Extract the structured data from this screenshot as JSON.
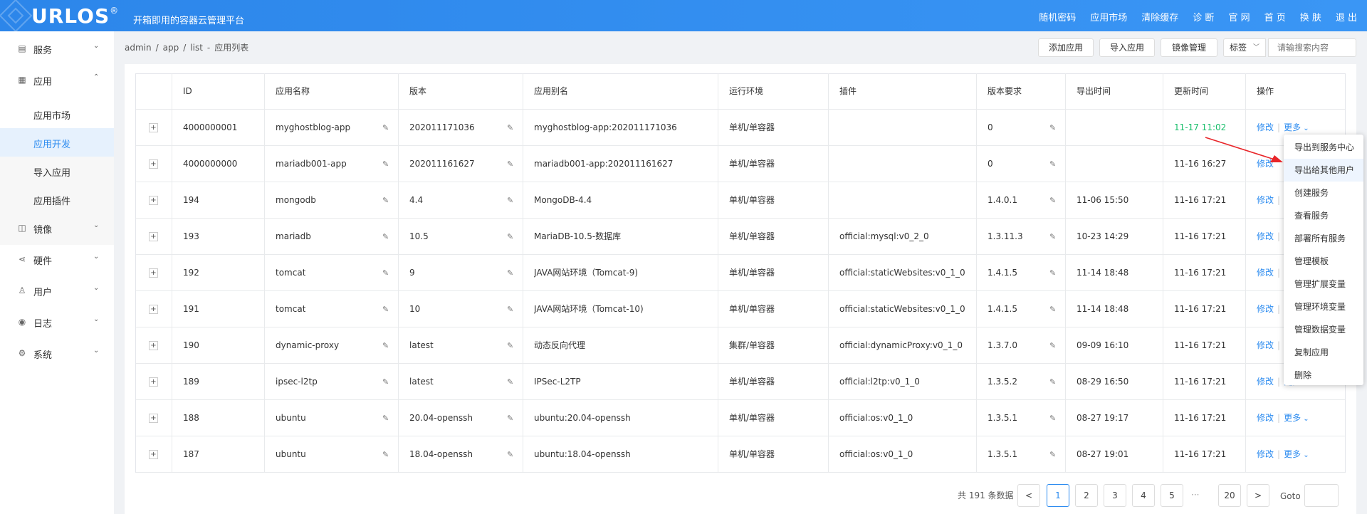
{
  "app": {
    "logo": "URLOS",
    "logo_reg": "®",
    "tagline": "开箱即用的容器云管理平台"
  },
  "topnav": [
    "随机密码",
    "应用市场",
    "清除缓存",
    "诊 断",
    "官 网",
    "首 页",
    "换 肤",
    "退 出"
  ],
  "sidebar": {
    "items": [
      {
        "label": "服务",
        "icon": "store-icon",
        "arrow": "⌄"
      },
      {
        "label": "应用",
        "icon": "grid-icon",
        "arrow": "⌃"
      },
      {
        "label": "镜像",
        "icon": "disk-icon",
        "arrow": "⌄"
      },
      {
        "label": "硬件",
        "icon": "share-icon",
        "arrow": "⌄"
      },
      {
        "label": "用户",
        "icon": "user-icon",
        "arrow": "⌄"
      },
      {
        "label": "日志",
        "icon": "eye-icon",
        "arrow": "⌄"
      },
      {
        "label": "系统",
        "icon": "gear-icon",
        "arrow": "⌄"
      }
    ],
    "subitems": [
      "应用市场",
      "应用开发",
      "导入应用",
      "应用插件"
    ],
    "active_sub": "应用开发"
  },
  "breadcrumb": {
    "parts": [
      "admin",
      "/",
      "app",
      "/",
      "list",
      "-",
      "应用列表"
    ]
  },
  "toolbar": {
    "add": "添加应用",
    "import": "导入应用",
    "image": "镜像管理",
    "tag_select": "标签",
    "search_placeholder": "请输搜索内容"
  },
  "table": {
    "columns": [
      "ID",
      "应用名称",
      "版本",
      "应用别名",
      "运行环境",
      "插件",
      "版本要求",
      "导出时间",
      "更新时间",
      "操作"
    ],
    "rows": [
      {
        "id": "4000000001",
        "name": "myghostblog-app",
        "version": "202011171036",
        "alias": "myghostblog-app:202011171036",
        "env": "单机/单容器",
        "plugin": "",
        "req": "0",
        "export": "",
        "update": "11-17 11:02",
        "update_green": true
      },
      {
        "id": "4000000000",
        "name": "mariadb001-app",
        "version": "202011161627",
        "alias": "mariadb001-app:202011161627",
        "env": "单机/单容器",
        "plugin": "",
        "req": "0",
        "export": "",
        "update": "11-16 16:27"
      },
      {
        "id": "194",
        "name": "mongodb",
        "version": "4.4",
        "alias": "MongoDB-4.4",
        "env": "单机/单容器",
        "plugin": "",
        "req": "1.4.0.1",
        "export": "11-06 15:50",
        "update": "11-16 17:21"
      },
      {
        "id": "193",
        "name": "mariadb",
        "version": "10.5",
        "alias": "MariaDB-10.5-数据库",
        "env": "单机/单容器",
        "plugin": "official:mysql:v0_2_0",
        "req": "1.3.11.3",
        "export": "10-23 14:29",
        "update": "11-16 17:21"
      },
      {
        "id": "192",
        "name": "tomcat",
        "version": "9",
        "alias": "JAVA网站环境（Tomcat-9)",
        "env": "单机/单容器",
        "plugin": "official:staticWebsites:v0_1_0",
        "req": "1.4.1.5",
        "export": "11-14 18:48",
        "update": "11-16 17:21"
      },
      {
        "id": "191",
        "name": "tomcat",
        "version": "10",
        "alias": "JAVA网站环境（Tomcat-10)",
        "env": "单机/单容器",
        "plugin": "official:staticWebsites:v0_1_0",
        "req": "1.4.1.5",
        "export": "11-14 18:48",
        "update": "11-16 17:21"
      },
      {
        "id": "190",
        "name": "dynamic-proxy",
        "version": "latest",
        "alias": "动态反向代理",
        "env": "集群/单容器",
        "plugin": "official:dynamicProxy:v0_1_0",
        "req": "1.3.7.0",
        "export": "09-09 16:10",
        "update": "11-16 17:21"
      },
      {
        "id": "189",
        "name": "ipsec-l2tp",
        "version": "latest",
        "alias": "IPSec-L2TP",
        "env": "单机/单容器",
        "plugin": "official:l2tp:v0_1_0",
        "req": "1.3.5.2",
        "export": "08-29 16:50",
        "update": "11-16 17:21"
      },
      {
        "id": "188",
        "name": "ubuntu",
        "version": "20.04-openssh",
        "alias": "ubuntu:20.04-openssh",
        "env": "单机/单容器",
        "plugin": "official:os:v0_1_0",
        "req": "1.3.5.1",
        "export": "08-27 19:17",
        "update": "11-16 17:21"
      },
      {
        "id": "187",
        "name": "ubuntu",
        "version": "18.04-openssh",
        "alias": "ubuntu:18.04-openssh",
        "env": "单机/单容器",
        "plugin": "official:os:v0_1_0",
        "req": "1.3.5.1",
        "export": "08-27 19:01",
        "update": "11-16 17:21"
      }
    ],
    "op_edit": "修改",
    "op_more": "更多"
  },
  "dropdown": {
    "items": [
      "导出到服务中心",
      "导出给其他用户",
      "创建服务",
      "查看服务",
      "部署所有服务",
      "管理模板",
      "管理扩展变量",
      "管理环境变量",
      "管理数据变量",
      "复制应用",
      "删除"
    ],
    "highlighted": "导出给其他用户"
  },
  "pagination": {
    "total": "共 191 条数据",
    "prev": "<",
    "pages": [
      "1",
      "2",
      "3",
      "4",
      "5"
    ],
    "dots": "···",
    "last": "20",
    "next": ">",
    "current": "1",
    "goto": "Goto"
  },
  "colors": {
    "accent": "#2d8cf0",
    "green": "#19be6b",
    "annotation": "#e8262a"
  }
}
